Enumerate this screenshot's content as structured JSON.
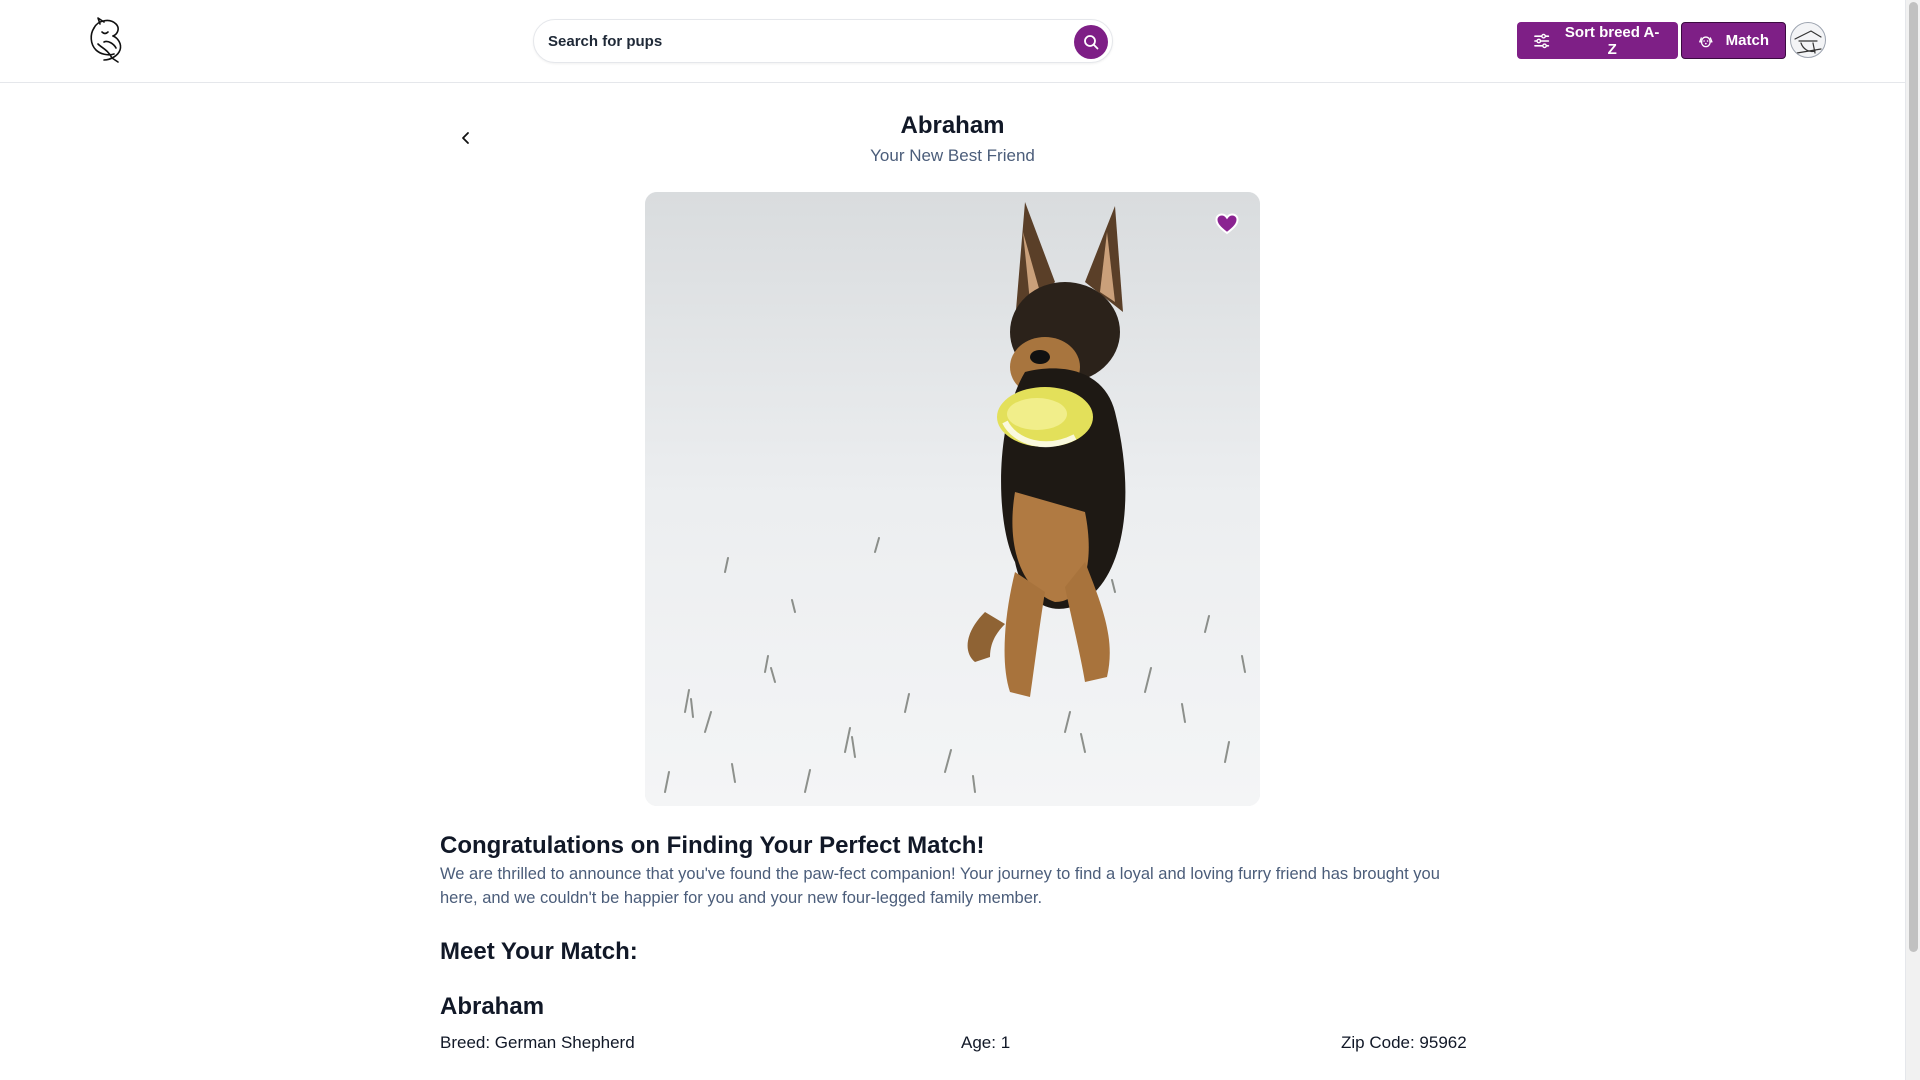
{
  "header": {
    "logo_icon": "dog-sketch-logo",
    "search": {
      "placeholder": "Search for pups",
      "value": ""
    },
    "sort_button": {
      "label": "Sort breed A-Z",
      "icon": "sliders-icon"
    },
    "match_button": {
      "label": "Match",
      "icon": "dog-face-icon"
    },
    "avatar_icon": "user-avatar"
  },
  "colors": {
    "accent": "#7e1f86",
    "subtitle_text": "#4b5d7a",
    "heading_text": "#111827"
  },
  "dog": {
    "name": "Abraham",
    "subtitle": "Your New Best Friend",
    "photo_alt": "dog-photo",
    "favorite": true
  },
  "content": {
    "congrats_heading": "Congratulations on Finding Your Perfect Match!",
    "congrats_body": "We are thrilled to announce that you've found the paw-fect companion! Your journey to find a loyal and loving furry friend has brought you here, and we couldn't be happier for you and your new four-legged family member.",
    "meet_heading": "Meet Your Match:",
    "match_name": "Abraham",
    "breed": "Breed: German Shepherd",
    "age": "Age: 1",
    "zip": "Zip Code: 95962"
  }
}
